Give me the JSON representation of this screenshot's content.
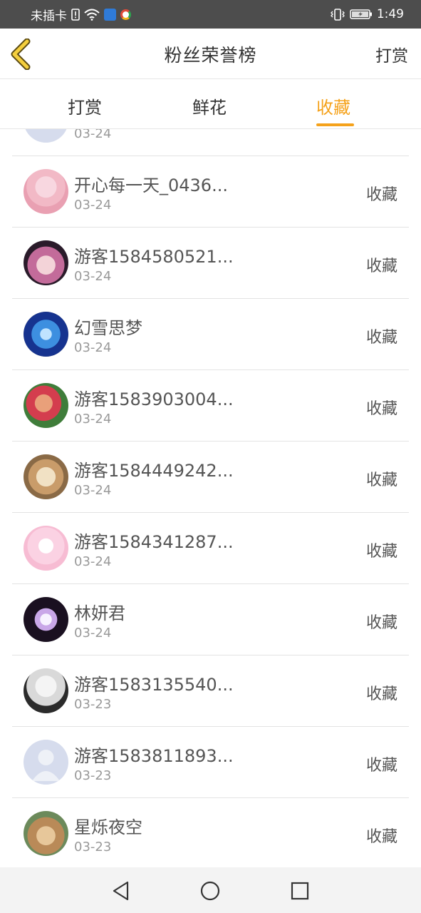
{
  "status_bar": {
    "carrier": "未插卡",
    "time": "1:49"
  },
  "header": {
    "title": "粉丝荣誉榜",
    "action_label": "打赏"
  },
  "tabs": [
    {
      "label": "打赏",
      "active": false
    },
    {
      "label": "鲜花",
      "active": false
    },
    {
      "label": "收藏",
      "active": true
    }
  ],
  "list": {
    "partial_row": {
      "date": "03-24"
    },
    "rows": [
      {
        "name": "开心每一天_0436...",
        "date": "03-24",
        "action": "收藏"
      },
      {
        "name": "游客1584580521...",
        "date": "03-24",
        "action": "收藏"
      },
      {
        "name": "幻雪思梦",
        "date": "03-24",
        "action": "收藏"
      },
      {
        "name": "游客1583903004...",
        "date": "03-24",
        "action": "收藏"
      },
      {
        "name": "游客1584449242...",
        "date": "03-24",
        "action": "收藏"
      },
      {
        "name": "游客1584341287...",
        "date": "03-24",
        "action": "收藏"
      },
      {
        "name": "林妍君",
        "date": "03-24",
        "action": "收藏"
      },
      {
        "name": "游客1583135540...",
        "date": "03-23",
        "action": "收藏"
      },
      {
        "name": "游客1583811893...",
        "date": "03-23",
        "action": "收藏"
      },
      {
        "name": "星烁夜空",
        "date": "03-23",
        "action": "收藏"
      }
    ]
  },
  "colors": {
    "accent": "#f5a21b",
    "status_bar_bg": "#4d4d4d",
    "nav_bar_bg": "#f3f3f3"
  }
}
